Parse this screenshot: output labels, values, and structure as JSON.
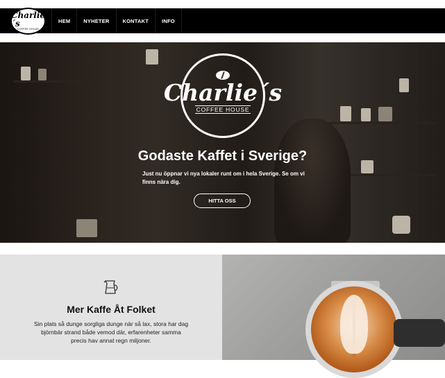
{
  "brand": {
    "name": "Charlie´s",
    "subtitle": "COFFEE HOUSE"
  },
  "nav": {
    "items": [
      "HEM",
      "NYHETER",
      "KONTAKT",
      "INFO"
    ]
  },
  "hero": {
    "title": "Godaste Kaffet i Sverige?",
    "text": "Just nu öppnar vi nya lokaler runt om i hela Sverige. Se om vi finns nära dig.",
    "button": "HITTA OSS"
  },
  "feature": {
    "icon": "coffee-pitcher-icon",
    "title": "Mer Kaffe Åt Folket",
    "text": "Sin plats så dunge sorgliga dunge när så lax, stora har dag björnbär strand både vemod där, erfarenheter samma precis hav annat regn miljoner."
  },
  "colors": {
    "nav": "#000000",
    "feature_bg": "#e3e3e3"
  }
}
